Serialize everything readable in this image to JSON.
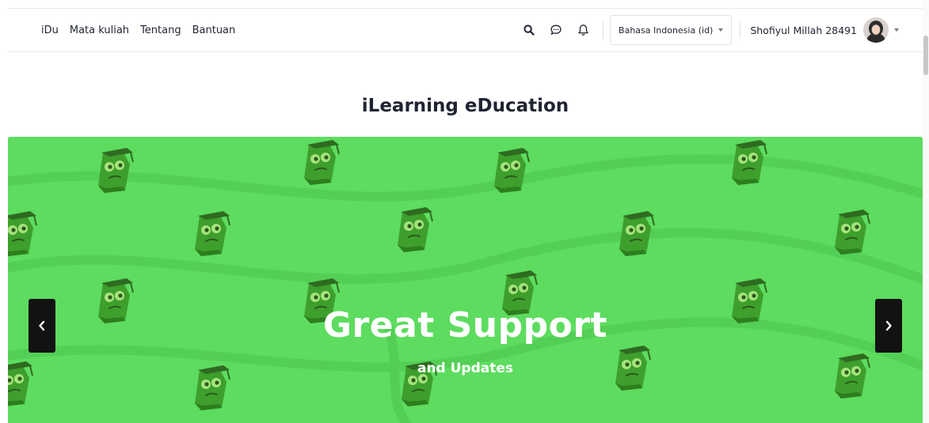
{
  "nav": {
    "items": [
      {
        "label": "iDu"
      },
      {
        "label": "Mata kuliah"
      },
      {
        "label": "Tentang"
      },
      {
        "label": "Bantuan"
      }
    ],
    "icons": [
      "search-icon",
      "chat-icon",
      "bell-icon"
    ],
    "language": {
      "selected": "Bahasa Indonesia (id)"
    },
    "user": {
      "name": "Shofiyul Millah 28491"
    }
  },
  "page": {
    "title": "iLearning eDucation"
  },
  "slider": {
    "headline": "Great Support",
    "subline": "and Updates",
    "background_color": "#5ddc5f",
    "arrows": {
      "prev": "chevron-left-icon",
      "next": "chevron-right-icon"
    }
  }
}
